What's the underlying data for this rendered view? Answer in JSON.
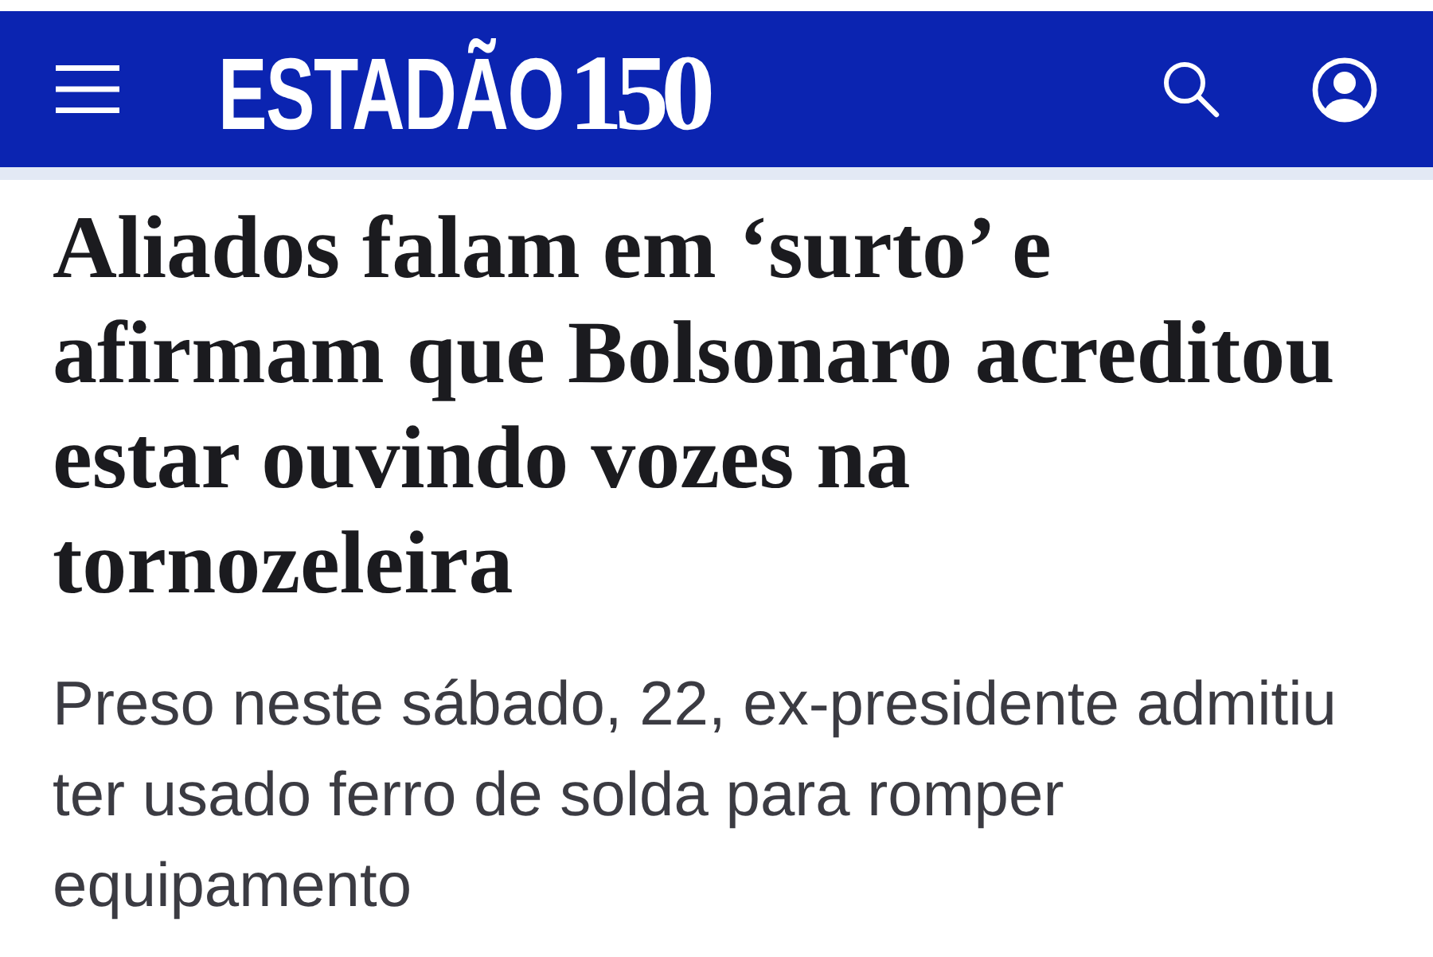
{
  "header": {
    "logo": {
      "wordmark": "ESTADÃO",
      "number": "150"
    }
  },
  "article": {
    "headline": "Aliados falam em ‘surto’ e afirmam que Bolsonaro acreditou estar ouvindo vozes na tornozeleira",
    "subheadline": "Preso neste sábado, 22, ex-presidente admitiu ter usado ferro de solda para romper equipamento"
  }
}
